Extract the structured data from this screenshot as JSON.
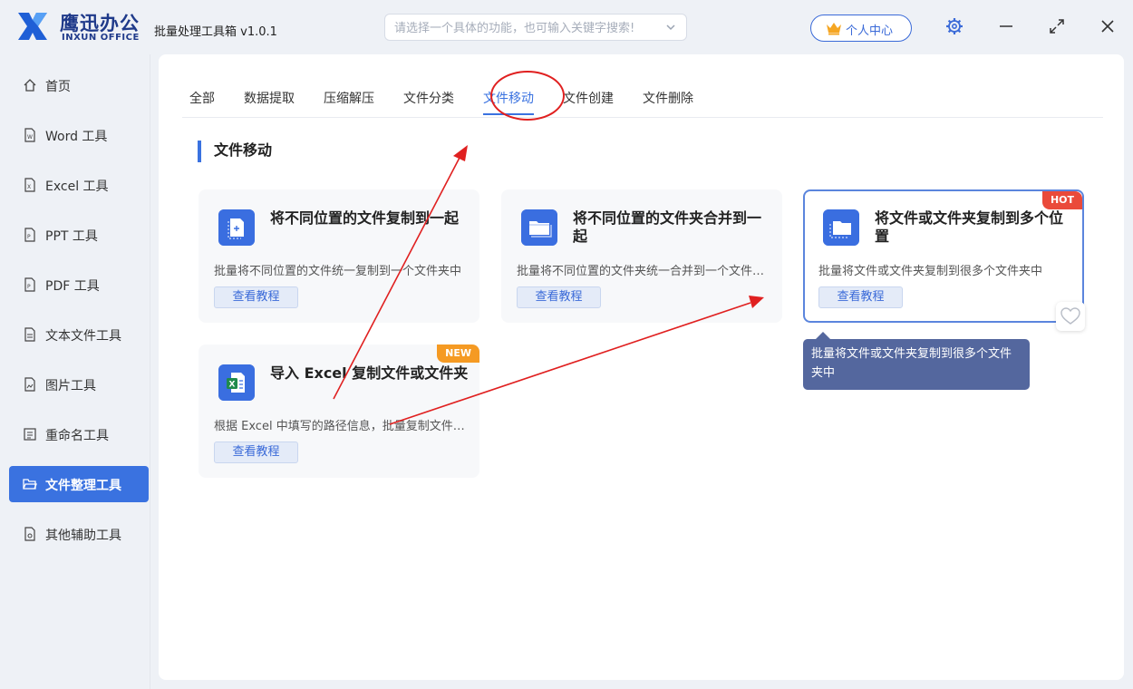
{
  "app": {
    "brand_cn": "鹰迅办公",
    "brand_en": "INXUN OFFICE",
    "title": "批量处理工具箱 v1.0.1",
    "search_placeholder": "请选择一个具体的功能，也可输入关键字搜索!",
    "user_center": "个人中心"
  },
  "sidebar": {
    "items": [
      {
        "label": "首页",
        "icon": "home-icon"
      },
      {
        "label": "Word 工具",
        "icon": "word-file-icon"
      },
      {
        "label": "Excel 工具",
        "icon": "excel-file-icon"
      },
      {
        "label": "PPT 工具",
        "icon": "ppt-file-icon"
      },
      {
        "label": "PDF 工具",
        "icon": "pdf-file-icon"
      },
      {
        "label": "文本文件工具",
        "icon": "text-file-icon"
      },
      {
        "label": "图片工具",
        "icon": "image-file-icon"
      },
      {
        "label": "重命名工具",
        "icon": "rename-icon"
      },
      {
        "label": "文件整理工具",
        "icon": "folder-open-icon",
        "active": true
      },
      {
        "label": "其他辅助工具",
        "icon": "tools-file-icon"
      }
    ]
  },
  "tabs": [
    {
      "label": "全部"
    },
    {
      "label": "数据提取"
    },
    {
      "label": "压缩解压"
    },
    {
      "label": "文件分类"
    },
    {
      "label": "文件移动",
      "active": true
    },
    {
      "label": "文件创建"
    },
    {
      "label": "文件删除"
    }
  ],
  "section_title": "文件移动",
  "cards": [
    {
      "title": "将不同位置的文件复制到一起",
      "desc": "批量将不同位置的文件统一复制到一个文件夹中",
      "button": "查看教程",
      "icon": "file-copy-icon"
    },
    {
      "title": "将不同位置的文件夹合并到一起",
      "desc": "批量将不同位置的文件夹统一合并到一个文件夹中",
      "button": "查看教程",
      "icon": "folder-merge-icon"
    },
    {
      "title": "将文件或文件夹复制到多个位置",
      "desc": "批量将文件或文件夹复制到很多个文件夹中",
      "button": "查看教程",
      "icon": "folder-copy-icon",
      "badge": "HOT"
    },
    {
      "title": "导入 Excel 复制文件或文件夹",
      "desc": "根据 Excel 中填写的路径信息，批量复制文件或文件夹",
      "button": "查看教程",
      "icon": "excel-import-icon",
      "badge": "NEW"
    }
  ],
  "tooltip": "批量将文件或文件夹复制到很多个文件夹中",
  "colors": {
    "accent": "#3a72e0",
    "hot": "#ea4a3a",
    "new": "#f59a23",
    "annotation": "#e02020"
  }
}
